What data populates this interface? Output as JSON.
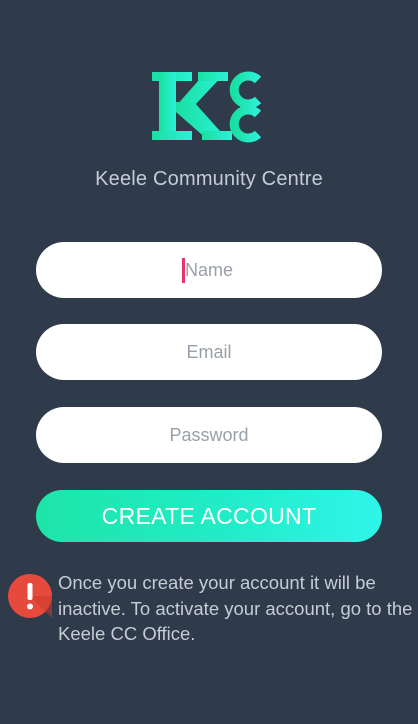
{
  "app": {
    "logo_text": "KCC",
    "subtitle": "Keele Community Centre",
    "colors": {
      "background": "#2f3b4a",
      "accent": "#22ecc0",
      "cursor": "#e8336b",
      "warning": "#e64a3c"
    }
  },
  "form": {
    "name_placeholder": "Name",
    "email_placeholder": "Email",
    "password_placeholder": "Password",
    "submit_label": "CREATE ACCOUNT"
  },
  "notice": {
    "icon": "alert-icon",
    "text": "Once you create your account it will be inactive. To activate your account, go to the Keele CC Office."
  }
}
